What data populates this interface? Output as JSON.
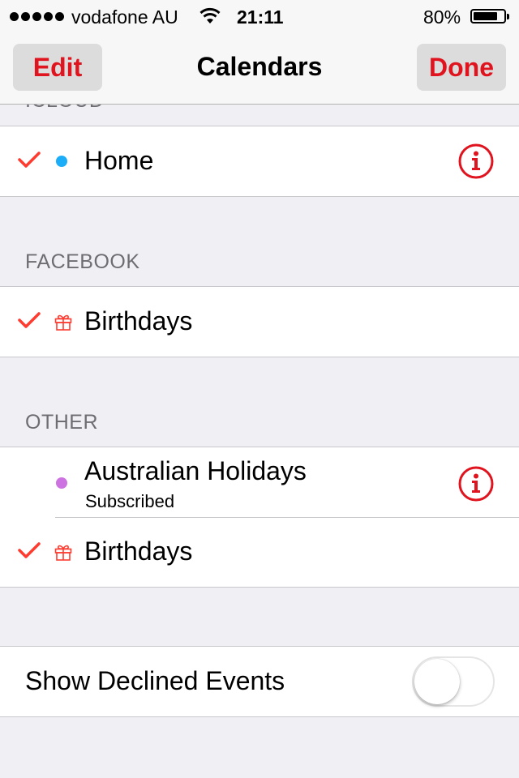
{
  "status_bar": {
    "carrier": "vodafone AU",
    "time": "21:11",
    "battery_percent": "80%",
    "battery_level": 0.8
  },
  "nav": {
    "edit_label": "Edit",
    "title": "Calendars",
    "done_label": "Done"
  },
  "sections": {
    "icloud": {
      "header": "ICLOUD",
      "items": [
        {
          "title": "Home",
          "checked": true,
          "color": "#1badf8"
        }
      ]
    },
    "facebook": {
      "header": "FACEBOOK",
      "items": [
        {
          "title": "Birthdays",
          "checked": true,
          "icon": "gift-icon"
        }
      ]
    },
    "other": {
      "header": "OTHER",
      "items": [
        {
          "title": "Australian Holidays",
          "subtitle": "Subscribed",
          "checked": false,
          "color": "#cc73e1"
        },
        {
          "title": "Birthdays",
          "checked": true,
          "icon": "gift-icon"
        }
      ]
    }
  },
  "settings": {
    "show_declined_label": "Show Declined Events",
    "show_declined_on": false
  },
  "colors": {
    "accent": "#e0141e",
    "checkmark": "#ff3b30",
    "background": "#efeff4"
  }
}
